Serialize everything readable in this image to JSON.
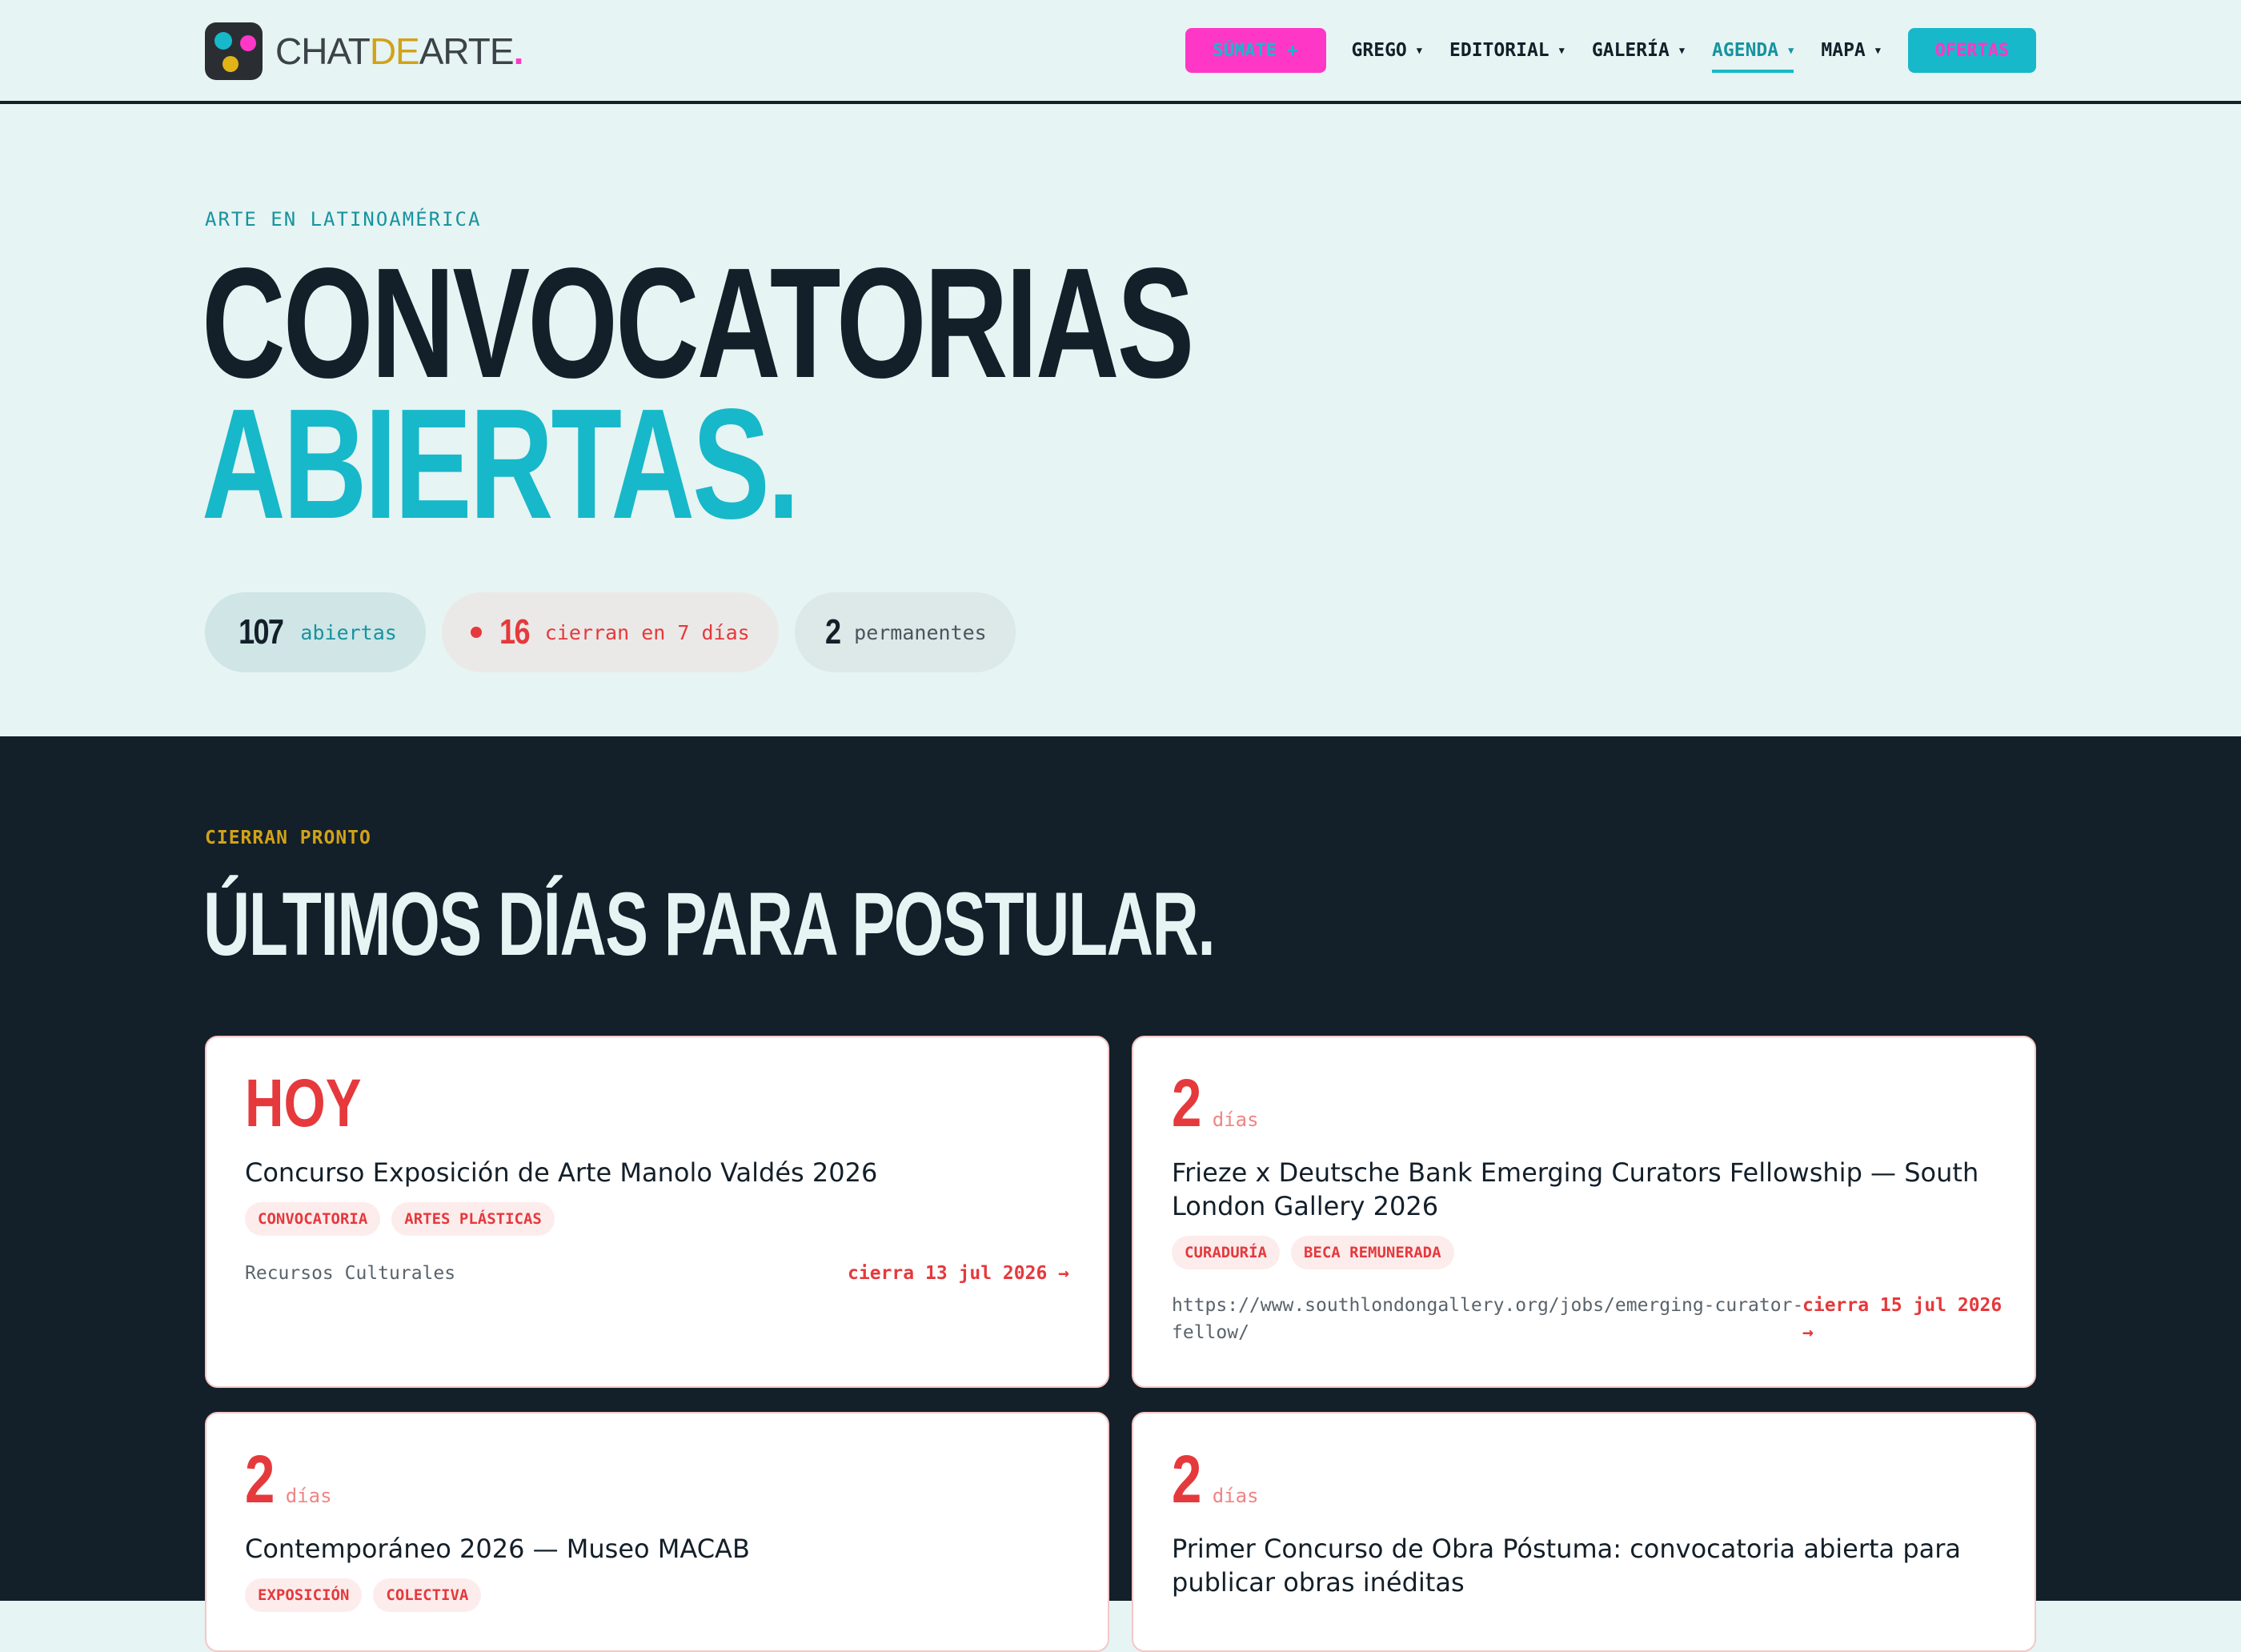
{
  "header": {
    "logo_parts": [
      "CHAT",
      "DE",
      "ARTE",
      "."
    ],
    "sumate_label": "SÚMATE +",
    "nav": [
      {
        "label": "GREGO",
        "active": false
      },
      {
        "label": "EDITORIAL",
        "active": false
      },
      {
        "label": "GALERÍA",
        "active": false
      },
      {
        "label": "AGENDA",
        "active": true
      },
      {
        "label": "MAPA",
        "active": false
      }
    ],
    "ofertas_label": "OFERTAS"
  },
  "hero": {
    "eyebrow": "ARTE EN LATINOAMÉRICA",
    "title_line1": "CONVOCATORIAS",
    "title_line2": "ABIERTAS.",
    "stats": [
      {
        "num": "107",
        "label": "abiertas"
      },
      {
        "num": "16",
        "label": "cierran en 7 días"
      },
      {
        "num": "2",
        "label": "permanentes"
      }
    ]
  },
  "closing": {
    "eyebrow": "CIERRAN PRONTO",
    "title": "ÚLTIMOS DÍAS PARA POSTULAR.",
    "cards": [
      {
        "count": "HOY",
        "unit": "",
        "title": "Concurso Exposición de Arte Manolo Valdés 2026",
        "tags": [
          "CONVOCATORIA",
          "ARTES PLÁSTICAS"
        ],
        "source": "Recursos Culturales",
        "closes": "cierra 13 jul 2026 →"
      },
      {
        "count": "2",
        "unit": "días",
        "title": "Frieze x Deutsche Bank Emerging Curators Fellowship — South London Gallery 2026",
        "tags": [
          "CURADURÍA",
          "BECA REMUNERADA"
        ],
        "source": "https://www.southlondongallery.org/jobs/emerging-curator-fellow/",
        "closes": "cierra 15 jul 2026 →"
      },
      {
        "count": "2",
        "unit": "días",
        "title": "Contemporáneo 2026 — Museo MACAB",
        "tags": [
          "EXPOSICIÓN",
          "COLECTIVA"
        ],
        "source": "",
        "closes": ""
      },
      {
        "count": "2",
        "unit": "días",
        "title": "Primer Concurso de Obra Póstuma: convocatoria abierta para publicar obras inéditas",
        "tags": [],
        "source": "",
        "closes": ""
      }
    ]
  },
  "colors": {
    "teal": "#17b8c9",
    "magenta": "#ff37c7",
    "gold": "#d1a219",
    "red": "#e5393c",
    "navy": "#131f29",
    "mint": "#e6f4f3"
  }
}
